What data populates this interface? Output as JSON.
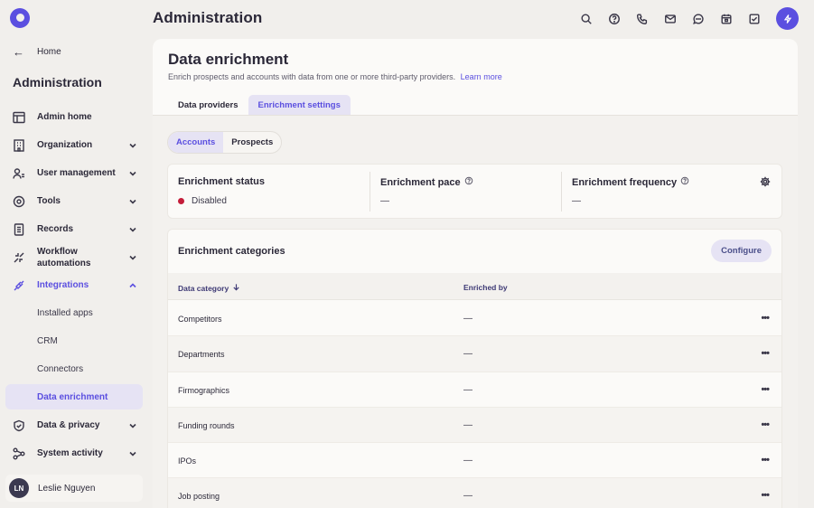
{
  "header": {
    "title": "Administration",
    "icons": [
      "search-icon",
      "help-icon",
      "phone-icon",
      "mail-icon",
      "chat-icon",
      "calendar-icon",
      "tasks-icon",
      "bolt-icon"
    ]
  },
  "sidebar": {
    "back_label": "Home",
    "title": "Administration",
    "items": [
      {
        "label": "Admin home",
        "icon": "layout-icon"
      },
      {
        "label": "Organization",
        "icon": "building-icon"
      },
      {
        "label": "User management",
        "icon": "users-icon"
      },
      {
        "label": "Tools",
        "icon": "tools-icon"
      },
      {
        "label": "Records",
        "icon": "records-icon"
      },
      {
        "label": "Workflow automations",
        "icon": "workflow-icon"
      },
      {
        "label": "Integrations",
        "icon": "plug-icon"
      },
      {
        "label": "Data & privacy",
        "icon": "shield-icon"
      },
      {
        "label": "System activity",
        "icon": "activity-icon"
      }
    ],
    "sub_items": [
      "Installed apps",
      "CRM",
      "Connectors",
      "Data enrichment"
    ],
    "user": {
      "initials": "LN",
      "name": "Leslie Nguyen"
    }
  },
  "page": {
    "title": "Data enrichment",
    "subtitle": "Enrich prospects and accounts with data from one or more third-party providers.",
    "learn_more": "Learn more",
    "tabs": [
      "Data providers",
      "Enrichment settings"
    ],
    "active_tab": "Enrichment settings",
    "segments": [
      "Accounts",
      "Prospects"
    ],
    "active_segment": "Accounts"
  },
  "status": {
    "status_label": "Enrichment status",
    "status_value": "Disabled",
    "status_color": "#c41d3a",
    "pace_label": "Enrichment pace",
    "pace_value": "—",
    "frequency_label": "Enrichment frequency",
    "frequency_value": "—"
  },
  "categories": {
    "title": "Enrichment categories",
    "configure_label": "Configure",
    "col_category": "Data category",
    "col_enriched_by": "Enriched by",
    "rows": [
      {
        "name": "Competitors",
        "by": "—"
      },
      {
        "name": "Departments",
        "by": "—"
      },
      {
        "name": "Firmographics",
        "by": "—"
      },
      {
        "name": "Funding rounds",
        "by": "—"
      },
      {
        "name": "IPOs",
        "by": "—"
      },
      {
        "name": "Job posting",
        "by": "—"
      }
    ],
    "more_label": "•••"
  },
  "colors": {
    "accent": "#5b4fe0",
    "selected_bg": "#e6e3f4",
    "background": "#f1efec"
  }
}
